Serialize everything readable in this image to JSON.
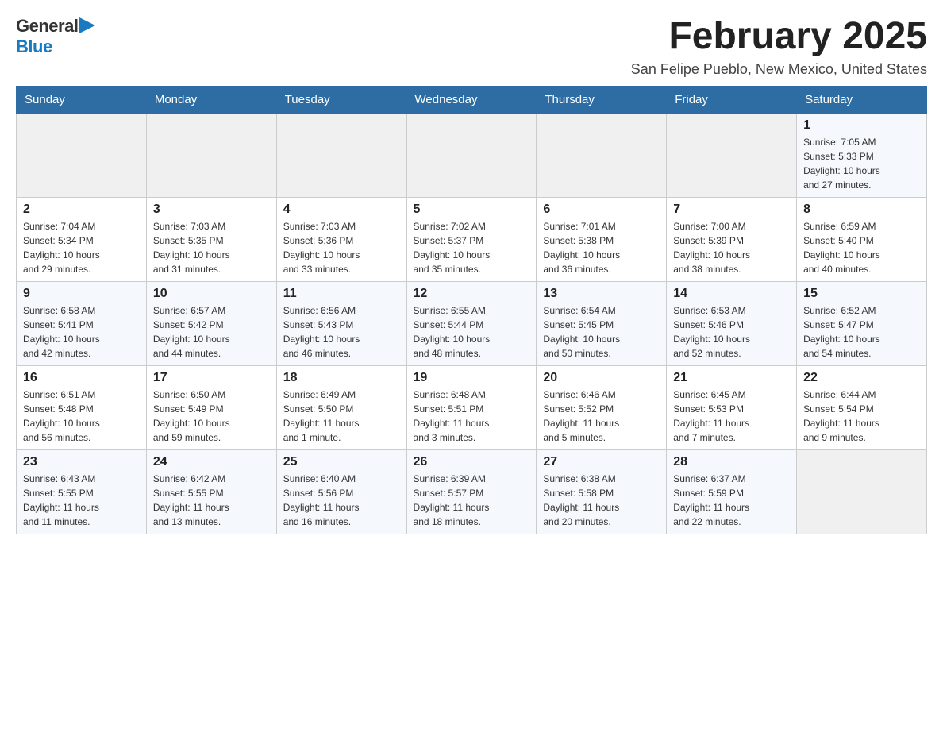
{
  "header": {
    "logo_general": "General",
    "logo_blue": "Blue",
    "month_title": "February 2025",
    "location": "San Felipe Pueblo, New Mexico, United States"
  },
  "days_of_week": [
    "Sunday",
    "Monday",
    "Tuesday",
    "Wednesday",
    "Thursday",
    "Friday",
    "Saturday"
  ],
  "weeks": [
    [
      {
        "day": "",
        "info": ""
      },
      {
        "day": "",
        "info": ""
      },
      {
        "day": "",
        "info": ""
      },
      {
        "day": "",
        "info": ""
      },
      {
        "day": "",
        "info": ""
      },
      {
        "day": "",
        "info": ""
      },
      {
        "day": "1",
        "info": "Sunrise: 7:05 AM\nSunset: 5:33 PM\nDaylight: 10 hours\nand 27 minutes."
      }
    ],
    [
      {
        "day": "2",
        "info": "Sunrise: 7:04 AM\nSunset: 5:34 PM\nDaylight: 10 hours\nand 29 minutes."
      },
      {
        "day": "3",
        "info": "Sunrise: 7:03 AM\nSunset: 5:35 PM\nDaylight: 10 hours\nand 31 minutes."
      },
      {
        "day": "4",
        "info": "Sunrise: 7:03 AM\nSunset: 5:36 PM\nDaylight: 10 hours\nand 33 minutes."
      },
      {
        "day": "5",
        "info": "Sunrise: 7:02 AM\nSunset: 5:37 PM\nDaylight: 10 hours\nand 35 minutes."
      },
      {
        "day": "6",
        "info": "Sunrise: 7:01 AM\nSunset: 5:38 PM\nDaylight: 10 hours\nand 36 minutes."
      },
      {
        "day": "7",
        "info": "Sunrise: 7:00 AM\nSunset: 5:39 PM\nDaylight: 10 hours\nand 38 minutes."
      },
      {
        "day": "8",
        "info": "Sunrise: 6:59 AM\nSunset: 5:40 PM\nDaylight: 10 hours\nand 40 minutes."
      }
    ],
    [
      {
        "day": "9",
        "info": "Sunrise: 6:58 AM\nSunset: 5:41 PM\nDaylight: 10 hours\nand 42 minutes."
      },
      {
        "day": "10",
        "info": "Sunrise: 6:57 AM\nSunset: 5:42 PM\nDaylight: 10 hours\nand 44 minutes."
      },
      {
        "day": "11",
        "info": "Sunrise: 6:56 AM\nSunset: 5:43 PM\nDaylight: 10 hours\nand 46 minutes."
      },
      {
        "day": "12",
        "info": "Sunrise: 6:55 AM\nSunset: 5:44 PM\nDaylight: 10 hours\nand 48 minutes."
      },
      {
        "day": "13",
        "info": "Sunrise: 6:54 AM\nSunset: 5:45 PM\nDaylight: 10 hours\nand 50 minutes."
      },
      {
        "day": "14",
        "info": "Sunrise: 6:53 AM\nSunset: 5:46 PM\nDaylight: 10 hours\nand 52 minutes."
      },
      {
        "day": "15",
        "info": "Sunrise: 6:52 AM\nSunset: 5:47 PM\nDaylight: 10 hours\nand 54 minutes."
      }
    ],
    [
      {
        "day": "16",
        "info": "Sunrise: 6:51 AM\nSunset: 5:48 PM\nDaylight: 10 hours\nand 56 minutes."
      },
      {
        "day": "17",
        "info": "Sunrise: 6:50 AM\nSunset: 5:49 PM\nDaylight: 10 hours\nand 59 minutes."
      },
      {
        "day": "18",
        "info": "Sunrise: 6:49 AM\nSunset: 5:50 PM\nDaylight: 11 hours\nand 1 minute."
      },
      {
        "day": "19",
        "info": "Sunrise: 6:48 AM\nSunset: 5:51 PM\nDaylight: 11 hours\nand 3 minutes."
      },
      {
        "day": "20",
        "info": "Sunrise: 6:46 AM\nSunset: 5:52 PM\nDaylight: 11 hours\nand 5 minutes."
      },
      {
        "day": "21",
        "info": "Sunrise: 6:45 AM\nSunset: 5:53 PM\nDaylight: 11 hours\nand 7 minutes."
      },
      {
        "day": "22",
        "info": "Sunrise: 6:44 AM\nSunset: 5:54 PM\nDaylight: 11 hours\nand 9 minutes."
      }
    ],
    [
      {
        "day": "23",
        "info": "Sunrise: 6:43 AM\nSunset: 5:55 PM\nDaylight: 11 hours\nand 11 minutes."
      },
      {
        "day": "24",
        "info": "Sunrise: 6:42 AM\nSunset: 5:55 PM\nDaylight: 11 hours\nand 13 minutes."
      },
      {
        "day": "25",
        "info": "Sunrise: 6:40 AM\nSunset: 5:56 PM\nDaylight: 11 hours\nand 16 minutes."
      },
      {
        "day": "26",
        "info": "Sunrise: 6:39 AM\nSunset: 5:57 PM\nDaylight: 11 hours\nand 18 minutes."
      },
      {
        "day": "27",
        "info": "Sunrise: 6:38 AM\nSunset: 5:58 PM\nDaylight: 11 hours\nand 20 minutes."
      },
      {
        "day": "28",
        "info": "Sunrise: 6:37 AM\nSunset: 5:59 PM\nDaylight: 11 hours\nand 22 minutes."
      },
      {
        "day": "",
        "info": ""
      }
    ]
  ]
}
